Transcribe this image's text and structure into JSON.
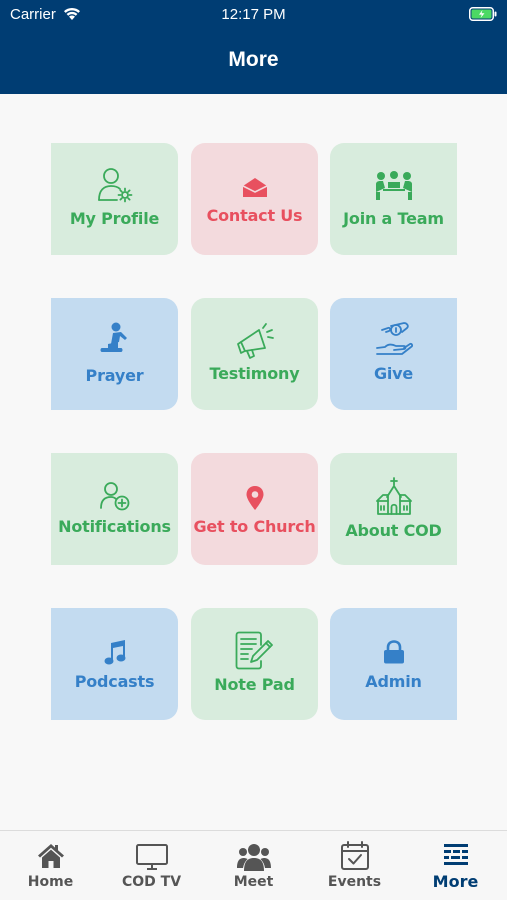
{
  "status_bar": {
    "carrier": "Carrier",
    "time": "12:17 PM"
  },
  "nav": {
    "title": "More"
  },
  "tiles": [
    {
      "label": "My Profile",
      "color": "#3aaa5a",
      "icon": "profile-gear-icon"
    },
    {
      "label": "Contact Us",
      "color": "#e8505f",
      "icon": "envelope-icon"
    },
    {
      "label": "Join a Team",
      "color": "#3aaa5a",
      "icon": "team-icon"
    },
    {
      "label": "Prayer",
      "color": "#3580c8",
      "icon": "praying-icon"
    },
    {
      "label": "Testimony",
      "color": "#3aaa5a",
      "icon": "megaphone-icon"
    },
    {
      "label": "Give",
      "color": "#3580c8",
      "icon": "giving-hand-icon"
    },
    {
      "label": "Notifications",
      "color": "#3aaa5a",
      "icon": "add-user-icon"
    },
    {
      "label": "Get to Church",
      "color": "#e8505f",
      "icon": "location-pin-icon"
    },
    {
      "label": "About COD",
      "color": "#3aaa5a",
      "icon": "church-icon"
    },
    {
      "label": "Podcasts",
      "color": "#3580c8",
      "icon": "music-note-icon"
    },
    {
      "label": "Note Pad",
      "color": "#3aaa5a",
      "icon": "notepad-icon"
    },
    {
      "label": "Admin",
      "color": "#3580c8",
      "icon": "lock-icon"
    }
  ],
  "tab_bar": {
    "items": [
      {
        "label": "Home",
        "icon": "home-icon"
      },
      {
        "label": "COD TV",
        "icon": "tv-icon"
      },
      {
        "label": "Meet",
        "icon": "group-icon"
      },
      {
        "label": "Events",
        "icon": "calendar-check-icon"
      },
      {
        "label": "More",
        "icon": "more-icon"
      }
    ],
    "active": "More"
  }
}
